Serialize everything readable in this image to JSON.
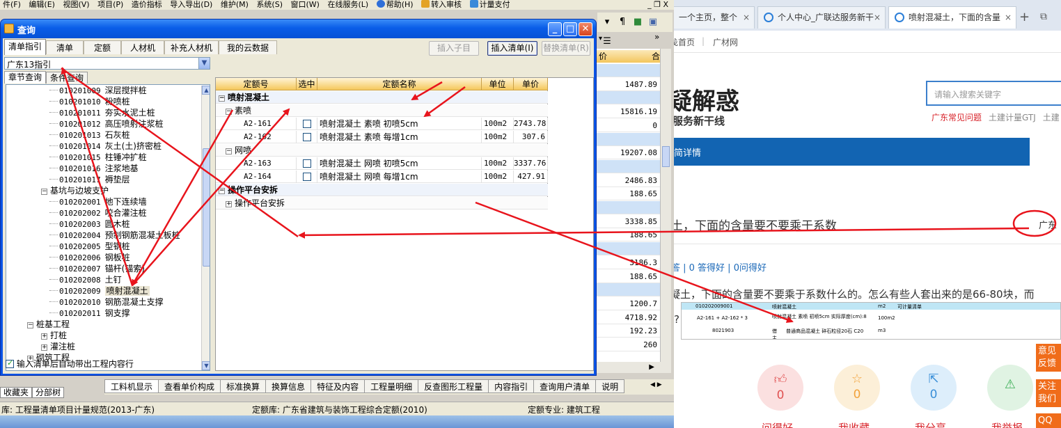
{
  "app": {
    "menu": [
      "件(F)",
      "编辑(E)",
      "视图(V)",
      "项目(P)",
      "造价指标",
      "导入导出(D)",
      "维护(M)",
      "系统(S)",
      "窗口(W)",
      "在线服务(L)",
      "帮助(H)",
      "转入审核",
      "计量支付"
    ],
    "window_buttons": "_ ❐ X",
    "behind_header": "价",
    "behind_header2": "合",
    "behind_values": [
      "",
      "1487.89",
      "",
      "15816.19",
      "0",
      "",
      "19207.08",
      "",
      "2486.83",
      "188.65",
      "",
      "3338.85",
      "188.65",
      "",
      "3186.3",
      "188.65",
      "",
      "1200.7",
      "4718.92",
      "192.23",
      "260"
    ],
    "bottom_tabs": [
      "工料机显示",
      "查看单价构成",
      "标准换算",
      "换算信息",
      "特征及内容",
      "工程量明细",
      "反查图形工程量",
      "内容指引",
      "查询用户清单",
      "说明"
    ],
    "left_tabs": [
      "收藏夹",
      "分部树"
    ],
    "status": {
      "list_lib": "库: 工程量清单项目计量规范(2013-广东)",
      "quota_lib": "定额库: 广东省建筑与装饰工程综合定额(2010)",
      "major": "定额专业: 建筑工程"
    }
  },
  "dialog": {
    "title": "查询",
    "tabs": [
      "清单指引",
      "清单",
      "定额",
      "人材机",
      "补充人材机",
      "我的云数据"
    ],
    "buttons": {
      "insert_child": "插入子目",
      "insert_list": "插入清单(I)",
      "replace_list": "替换清单(R)"
    },
    "combo_value": "广东13指引",
    "subtabs": [
      "章节查询",
      "条件查询"
    ],
    "tree": [
      {
        "code": "010201009",
        "name": "深层搅拌桩",
        "level": 3
      },
      {
        "code": "010201010",
        "name": "粉喷桩",
        "level": 3
      },
      {
        "code": "010201011",
        "name": "夯实水泥土桩",
        "level": 3
      },
      {
        "code": "010201012",
        "name": "高压喷射注浆桩",
        "level": 3
      },
      {
        "code": "010201013",
        "name": "石灰桩",
        "level": 3
      },
      {
        "code": "010201014",
        "name": "灰土(土)挤密桩",
        "level": 3
      },
      {
        "code": "010201015",
        "name": "柱锤冲扩桩",
        "level": 3
      },
      {
        "code": "010201016",
        "name": "注浆地基",
        "level": 3
      },
      {
        "code": "010201017",
        "name": "褥垫层",
        "level": 3
      },
      {
        "code": "",
        "name": "基坑与边坡支护",
        "level": 2,
        "toggle": "−"
      },
      {
        "code": "010202001",
        "name": "地下连续墙",
        "level": 3
      },
      {
        "code": "010202002",
        "name": "咬合灌注桩",
        "level": 3
      },
      {
        "code": "010202003",
        "name": "圆木桩",
        "level": 3
      },
      {
        "code": "010202004",
        "name": "预制钢筋混凝土板桩",
        "level": 3
      },
      {
        "code": "010202005",
        "name": "型钢桩",
        "level": 3
      },
      {
        "code": "010202006",
        "name": "钢板桩",
        "level": 3
      },
      {
        "code": "010202007",
        "name": "锚杆(锚索)",
        "level": 3
      },
      {
        "code": "010202008",
        "name": "土钉",
        "level": 3
      },
      {
        "code": "010202009",
        "name": "喷射混凝土",
        "level": 3,
        "selected": true
      },
      {
        "code": "010202010",
        "name": "钢筋混凝土支撑",
        "level": 3
      },
      {
        "code": "010202011",
        "name": "钢支撑",
        "level": 3
      },
      {
        "code": "",
        "name": "桩基工程",
        "level": 1,
        "toggle": "−"
      },
      {
        "code": "",
        "name": "打桩",
        "level": 2,
        "toggle": "+"
      },
      {
        "code": "",
        "name": "灌注桩",
        "level": 2,
        "toggle": "+"
      },
      {
        "code": "",
        "name": "砌筑工程",
        "level": 1,
        "toggle": "+"
      }
    ],
    "grid": {
      "headers": [
        "定额号",
        "选中",
        "定额名称",
        "单位",
        "单价"
      ],
      "rows": [
        {
          "type": "group1",
          "toggle": "−",
          "label": "喷射混凝土"
        },
        {
          "type": "group2",
          "toggle": "−",
          "label": "素喷"
        },
        {
          "type": "item",
          "code": "A2-161",
          "name": "喷射混凝土 素喷 初喷5cm",
          "unit": "100m2",
          "price": "2743.78"
        },
        {
          "type": "item",
          "code": "A2-162",
          "name": "喷射混凝土 素喷 每增1cm",
          "unit": "100m2",
          "price": "307.6"
        },
        {
          "type": "group2",
          "toggle": "−",
          "label": "网喷"
        },
        {
          "type": "item",
          "code": "A2-163",
          "name": "喷射混凝土 网喷 初喷5cm",
          "unit": "100m2",
          "price": "3337.76"
        },
        {
          "type": "item",
          "code": "A2-164",
          "name": "喷射混凝土 网喷 每增1cm",
          "unit": "100m2",
          "price": "427.91"
        },
        {
          "type": "group1",
          "toggle": "−",
          "label": "操作平台安拆"
        },
        {
          "type": "group2",
          "toggle": "+",
          "label": "操作平台安拆"
        }
      ]
    },
    "auto_checkbox": "输入清单后自动带出工程内容行"
  },
  "browser": {
    "tabs": [
      {
        "label": "一个主页，整个",
        "active": false
      },
      {
        "label": "个人中心_广联达服务新干",
        "active": false
      },
      {
        "label": "喷射混凝土，下面的含量",
        "active": true
      }
    ],
    "nav": [
      "戋首页",
      "|",
      "广材网"
    ],
    "logo": "疑解惑",
    "logo_sub": "服务新干线",
    "search_placeholder": "请输入搜索关键字",
    "quicklinks": [
      "广东常见问题",
      "土建计量GTJ",
      "土建"
    ],
    "bluebar": "简详情",
    "question_title": "土，下面的含量要不要乘于系数",
    "province": "广东",
    "stats": "答 | 0 答得好 | 0问得好",
    "body": "凝土，下面的含量要不要乘于系数什么的。怎么有些人套出来的是66-80块，而",
    "qmark": "?",
    "mini": {
      "code": "010202009001",
      "name1": "喷射混凝土",
      "unit1": "m2",
      "extra": "可计量清单",
      "sub": "A2-161 + A2-162 * 3",
      "name2": "喷射混凝土 素喷 初喷5cm 实际厚度(cm):8",
      "unit2": "100m2",
      "code3": "8021903",
      "tag3": "借",
      "name3": "普通商品混凝土 碎石粒径20石 C20",
      "unit3": "m3",
      "tag4": "主"
    },
    "actions": [
      {
        "label": "问得好",
        "count": "0"
      },
      {
        "label": "我收藏",
        "count": "0"
      },
      {
        "label": "我分享",
        "count": "0"
      },
      {
        "label": "我举报",
        "count": ""
      }
    ],
    "float_btns": [
      "意见反馈",
      "关注我们",
      "QQ"
    ]
  },
  "colors": {
    "annotation": "#e8141c",
    "dialog_blue": "#0a54e6",
    "grid_header": "#f5c85c",
    "browser_blue": "#1264b2"
  }
}
